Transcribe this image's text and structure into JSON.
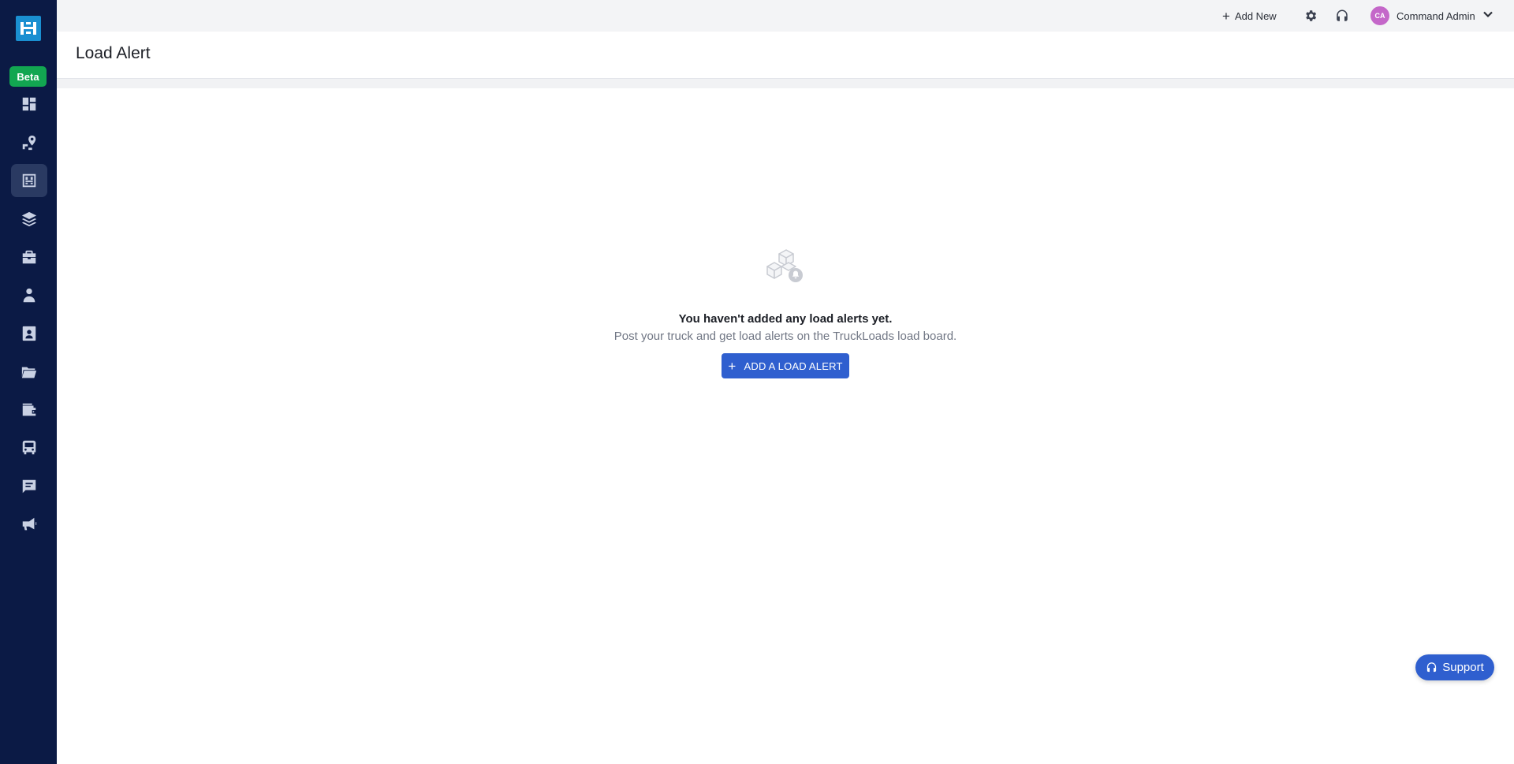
{
  "sidebar": {
    "beta_label": "Beta",
    "items": [
      {
        "icon": "dashboard-icon"
      },
      {
        "icon": "route-icon"
      },
      {
        "icon": "loadboard-icon",
        "active": true
      },
      {
        "icon": "layers-icon"
      },
      {
        "icon": "briefcase-icon"
      },
      {
        "icon": "driver-icon"
      },
      {
        "icon": "contact-card-icon"
      },
      {
        "icon": "folder-icon"
      },
      {
        "icon": "wallet-icon"
      },
      {
        "icon": "truck-icon"
      },
      {
        "icon": "message-icon"
      },
      {
        "icon": "megaphone-icon"
      }
    ]
  },
  "topbar": {
    "add_new_label": "Add New",
    "user_initials": "CA",
    "user_name": "Command Admin"
  },
  "header": {
    "title": "Load Alert"
  },
  "empty_state": {
    "title": "You haven't added any load alerts yet.",
    "subtitle": "Post your truck and get load alerts on the TruckLoads load board.",
    "button_label": "ADD A LOAD ALERT"
  },
  "support": {
    "label": "Support"
  },
  "colors": {
    "sidebar_bg": "#0b1a45",
    "primary": "#2f5fcf",
    "beta_green": "#12a651",
    "avatar": "#c467c9"
  }
}
